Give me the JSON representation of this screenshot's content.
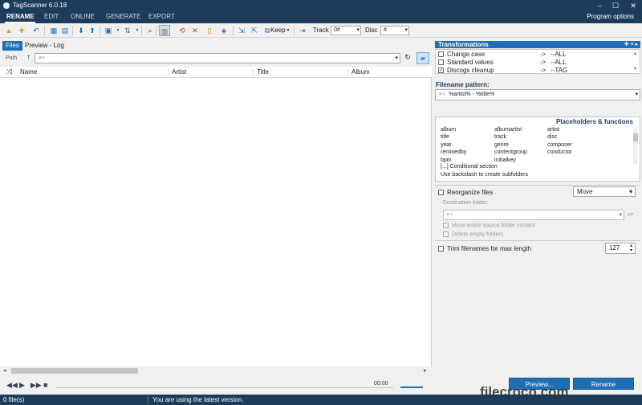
{
  "window": {
    "title": "TagScanner 6.0.18",
    "controls": {
      "minimize": "–",
      "maximize": "☐",
      "close": "✕"
    }
  },
  "menu": {
    "items": [
      "RENAME",
      "EDIT",
      "ONLINE",
      "GENERATE",
      "EXPORT"
    ],
    "active": "RENAME",
    "program_options": "Program options"
  },
  "toolbar": {
    "keep_label": "Keep",
    "track_label": "Track",
    "track_value": "0#",
    "disc_label": "Disc",
    "disc_value": "#"
  },
  "left": {
    "tabs": [
      "Files",
      "Preview - Log"
    ],
    "path_label": "Path",
    "path_value": "≡+",
    "columns": [
      "Name",
      "Artist",
      "Title",
      "Album"
    ],
    "player_time": "00:00"
  },
  "transformations": {
    "title": "Transformations",
    "rows": [
      {
        "label": "Change case",
        "checked": false,
        "arrow": "->",
        "target": "--ALL"
      },
      {
        "label": "Standard values",
        "checked": false,
        "arrow": "->",
        "target": "--ALL"
      },
      {
        "label": "Discogs cleanup",
        "checked": true,
        "arrow": "->",
        "target": "--TAG"
      }
    ]
  },
  "filename_pattern": {
    "label": "Filename pattern:",
    "value": "%artist% - %title%",
    "prefix": "≡+"
  },
  "placeholders": {
    "title": "Placeholders & functions",
    "items": [
      [
        "album",
        "albumartist",
        "artist"
      ],
      [
        "title",
        "track",
        "disc"
      ],
      [
        "year",
        "genre",
        "composer"
      ],
      [
        "remixedby",
        "contentgroup",
        "conductor"
      ],
      [
        "bpm",
        "initialkey",
        ""
      ]
    ],
    "conditional": "[...] Conditional section",
    "backslash": "Use backslash to create subfolders"
  },
  "reorganize": {
    "label": "Reorganize files",
    "mode": "Move",
    "dest_label": "Destination folder:",
    "dest_value": "≡+",
    "opt_move": "Move entire source folder content",
    "opt_delete": "Delete empty folders"
  },
  "trim": {
    "label": "Trim filenames for max length",
    "value": "127"
  },
  "buttons": {
    "preview": "Preview...",
    "rename": "Rename"
  },
  "status": {
    "files": "0 file(s)",
    "message": "You are using the latest version."
  },
  "watermark": "filecroco.com",
  "colors": {
    "titlebar": "#1d3b5a",
    "accent": "#1f6fb4"
  }
}
